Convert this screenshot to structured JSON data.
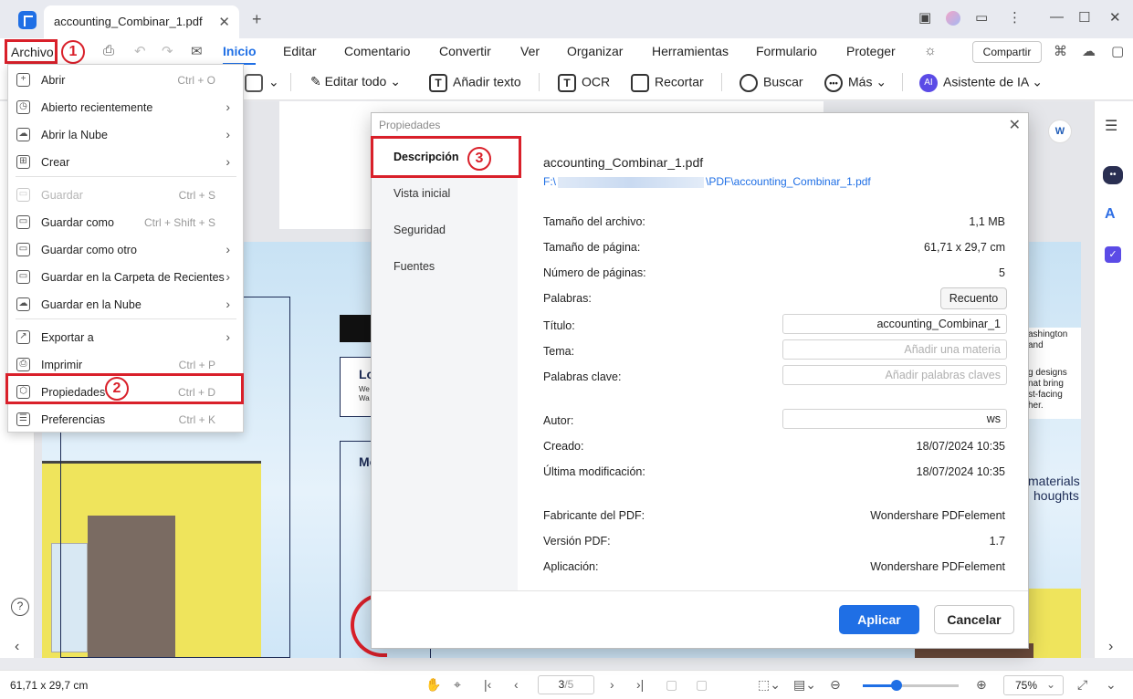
{
  "titlebar": {
    "tab_title": "accounting_Combinar_1.pdf",
    "tab_close": "✕",
    "new_tab": "+",
    "minimize": "—",
    "maximize": "☐",
    "close": "✕"
  },
  "menubar": {
    "archivo": "Archivo",
    "items": [
      "Inicio",
      "Editar",
      "Comentario",
      "Convertir",
      "Ver",
      "Organizar",
      "Herramientas",
      "Formulario",
      "Proteger"
    ],
    "compartir": "Compartir"
  },
  "annotations": {
    "step1": "1",
    "step2": "2",
    "step3": "3"
  },
  "toolbar": {
    "editar_todo": "Editar todo",
    "anadir_texto": "Añadir texto",
    "ocr": "OCR",
    "recortar": "Recortar",
    "buscar": "Buscar",
    "mas": "Más",
    "asistente": "Asistente de IA",
    "ai_badge": "AI"
  },
  "file_menu": {
    "items": [
      {
        "label": "Abrir",
        "shortcut": "Ctrl + O",
        "arrow": "",
        "disabled": false
      },
      {
        "label": "Abierto recientemente",
        "shortcut": "",
        "arrow": "›",
        "disabled": false
      },
      {
        "label": "Abrir la Nube",
        "shortcut": "",
        "arrow": "›",
        "disabled": false
      },
      {
        "label": "Crear",
        "shortcut": "",
        "arrow": "›",
        "disabled": false
      },
      {
        "label": "Guardar",
        "shortcut": "Ctrl + S",
        "arrow": "",
        "disabled": true
      },
      {
        "label": "Guardar como",
        "shortcut": "Ctrl + Shift + S",
        "arrow": "",
        "disabled": false
      },
      {
        "label": "Guardar como otro",
        "shortcut": "",
        "arrow": "›",
        "disabled": false
      },
      {
        "label": "Guardar en la Carpeta de Recientes",
        "shortcut": "",
        "arrow": "›",
        "disabled": false
      },
      {
        "label": "Guardar en la Nube",
        "shortcut": "",
        "arrow": "›",
        "disabled": false
      },
      {
        "label": "Exportar a",
        "shortcut": "",
        "arrow": "›",
        "disabled": false
      },
      {
        "label": "Imprimir",
        "shortcut": "Ctrl + P",
        "arrow": "",
        "disabled": false
      },
      {
        "label": "Propiedades",
        "shortcut": "Ctrl + D",
        "arrow": "",
        "disabled": false
      },
      {
        "label": "Preferencias",
        "shortcut": "Ctrl + K",
        "arrow": "",
        "disabled": false
      }
    ]
  },
  "dialog": {
    "title": "Propiedades",
    "close": "✕",
    "tabs": [
      "Descripción",
      "Vista inicial",
      "Seguridad",
      "Fuentes"
    ],
    "file_name": "accounting_Combinar_1.pdf",
    "path_prefix": "F:\\",
    "path_suffix": "\\PDF\\accounting_Combinar_1.pdf",
    "properties": {
      "file_size_label": "Tamaño del archivo:",
      "file_size": "1,1 MB",
      "page_size_label": "Tamaño de página:",
      "page_size": "61,71 x 29,7 cm",
      "page_count_label": "Número de páginas:",
      "page_count": "5",
      "words_label": "Palabras:",
      "words_button": "Recuento",
      "title_label": "Título:",
      "title_value": "accounting_Combinar_1",
      "subject_label": "Tema:",
      "subject_placeholder": "Añadir una materia",
      "keywords_label": "Palabras clave:",
      "keywords_placeholder": "Añadir palabras claves",
      "author_label": "Autor:",
      "author_value": "ws",
      "created_label": "Creado:",
      "created": "18/07/2024 10:35",
      "modified_label": "Última modificación:",
      "modified": "18/07/2024 10:35",
      "producer_label": "Fabricante del PDF:",
      "producer": "Wondershare PDFelement",
      "version_label": "Versión PDF:",
      "version": "1.7",
      "application_label": "Aplicación:",
      "application": "Wondershare PDFelement"
    },
    "apply": "Aplicar",
    "cancel": "Cancelar"
  },
  "document_snippets": {
    "lo": "Lo",
    "we": "We",
    "wa": "Wa",
    "mo": "Mo",
    "r1": "ashington",
    "r2": "and",
    "r3": "g designs",
    "r4": "nat bring",
    "r5": "st-facing",
    "r6": "her.",
    "r7": "materials",
    "r8": "houghts"
  },
  "statusbar": {
    "page_dimensions": "61,71 x 29,7 cm",
    "page_current": "3",
    "page_total": "/5",
    "zoom": "75%",
    "zoom_level": 0.35
  },
  "colors": {
    "accent": "#1f6fe5",
    "highlight_red": "#d9202a"
  }
}
